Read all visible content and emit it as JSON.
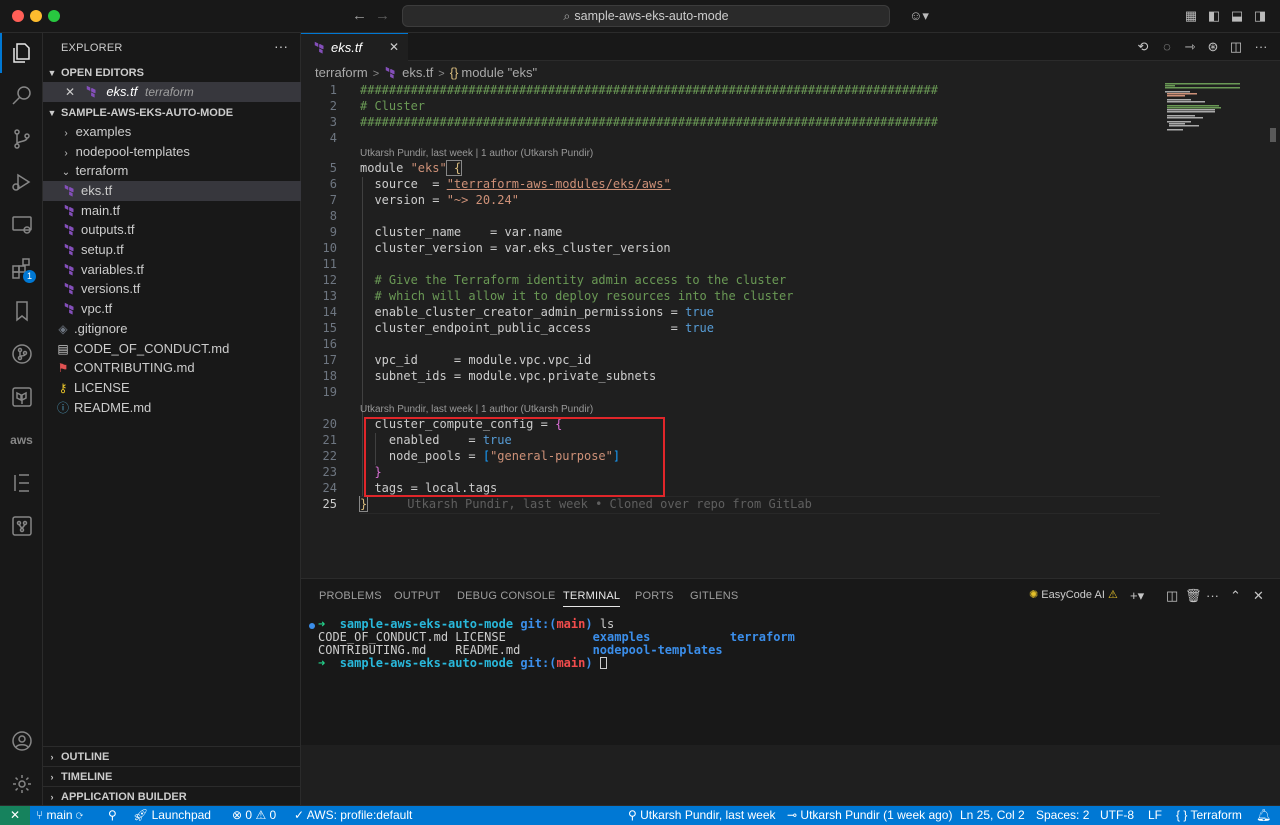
{
  "titlebar": {
    "search_text": "sample-aws-eks-auto-mode"
  },
  "activity": {
    "extensions_badge": "1"
  },
  "sidebar": {
    "title": "EXPLORER",
    "open_editors_label": "OPEN EDITORS",
    "open_editor": {
      "name": "eks.tf",
      "folder": "terraform"
    },
    "project_label": "SAMPLE-AWS-EKS-AUTO-MODE",
    "tree": [
      {
        "label": "examples",
        "type": "folder"
      },
      {
        "label": "nodepool-templates",
        "type": "folder"
      },
      {
        "label": "terraform",
        "type": "folder-open"
      },
      {
        "label": "eks.tf",
        "type": "tf"
      },
      {
        "label": "main.tf",
        "type": "tf"
      },
      {
        "label": "outputs.tf",
        "type": "tf"
      },
      {
        "label": "setup.tf",
        "type": "tf"
      },
      {
        "label": "variables.tf",
        "type": "tf"
      },
      {
        "label": "versions.tf",
        "type": "tf"
      },
      {
        "label": "vpc.tf",
        "type": "tf"
      },
      {
        "label": ".gitignore",
        "type": "git"
      },
      {
        "label": "CODE_OF_CONDUCT.md",
        "type": "md"
      },
      {
        "label": "CONTRIBUTING.md",
        "type": "contrib"
      },
      {
        "label": "LICENSE",
        "type": "license"
      },
      {
        "label": "README.md",
        "type": "info"
      }
    ],
    "outline_label": "OUTLINE",
    "timeline_label": "TIMELINE",
    "app_builder_label": "APPLICATION BUILDER"
  },
  "editor": {
    "tab_label": "eks.tf",
    "breadcrumb": {
      "folder": "terraform",
      "file": "eks.tf",
      "symbol": "module \"eks\""
    },
    "lens_1": "Utkarsh Pundir, last week | 1 author (Utkarsh Pundir)",
    "lens_2": "Utkarsh Pundir, last week | 1 author (Utkarsh Pundir)",
    "blame_inline": "Utkarsh Pundir, last week • Cloned over repo from GitLab",
    "line_numbers": [
      "1",
      "2",
      "3",
      "4",
      "5",
      "6",
      "7",
      "8",
      "9",
      "10",
      "11",
      "12",
      "13",
      "14",
      "15",
      "16",
      "17",
      "18",
      "19",
      "20",
      "21",
      "22",
      "23",
      "24",
      "25"
    ],
    "lines": {
      "l1": "################################################################################",
      "l2": "# Cluster",
      "l3": "################################################################################",
      "l5a": "module ",
      "l5b": "\"eks\"",
      "l5c": " {",
      "l6a": "  source  = ",
      "l6b": "\"terraform-aws-modules/eks/aws\"",
      "l7a": "  version = ",
      "l7b": "\"~> 20.24\"",
      "l9": "  cluster_name    = var.name",
      "l10": "  cluster_version = var.eks_cluster_version",
      "l12": "  # Give the Terraform identity admin access to the cluster",
      "l13": "  # which will allow it to deploy resources into the cluster",
      "l14a": "  enable_cluster_creator_admin_permissions = ",
      "l14b": "true",
      "l15a": "  cluster_endpoint_public_access           = ",
      "l15b": "true",
      "l17": "  vpc_id     = module.vpc.vpc_id",
      "l18": "  subnet_ids = module.vpc.private_subnets",
      "l20a": "  cluster_compute_config = ",
      "l20b": "{",
      "l21a": "    enabled    = ",
      "l21b": "true",
      "l22a": "    node_pools = ",
      "l22b": "[",
      "l22c": "\"general-purpose\"",
      "l22d": "]",
      "l23": "  }",
      "l24": "  tags = local.tags",
      "l25": "}"
    }
  },
  "panel": {
    "tabs": [
      "PROBLEMS",
      "OUTPUT",
      "DEBUG CONSOLE",
      "TERMINAL",
      "PORTS",
      "GITLENS"
    ],
    "easycode_label": "EasyCode AI",
    "terminal": {
      "arrow": "➜",
      "dir": "sample-aws-eks-auto-mode",
      "git_prefix": "git:(",
      "branch": "main",
      "git_suffix": ")",
      "cmd": "ls",
      "row1_a": "CODE_OF_CONDUCT.md",
      "row1_b": "LICENSE",
      "row1_c": "examples",
      "row1_d": "terraform",
      "row2_a": "CONTRIBUTING.md",
      "row2_b": "README.md",
      "row2_c": "nodepool-templates"
    }
  },
  "statusbar": {
    "branch": "main",
    "launchpad": "Launchpad",
    "errors": "0",
    "warnings": "0",
    "aws_profile": "AWS: profile:default",
    "blame": "Utkarsh Pundir, last week",
    "commit": "Utkarsh Pundir (1 week ago)",
    "cursor": "Ln 25, Col 2",
    "spaces": "Spaces: 2",
    "encoding": "UTF-8",
    "eol": "LF",
    "language": "Terraform"
  },
  "colors": {
    "accent": "#0078d4",
    "highlight_box": "#e0262a",
    "terraform_purple": "#844fba"
  }
}
